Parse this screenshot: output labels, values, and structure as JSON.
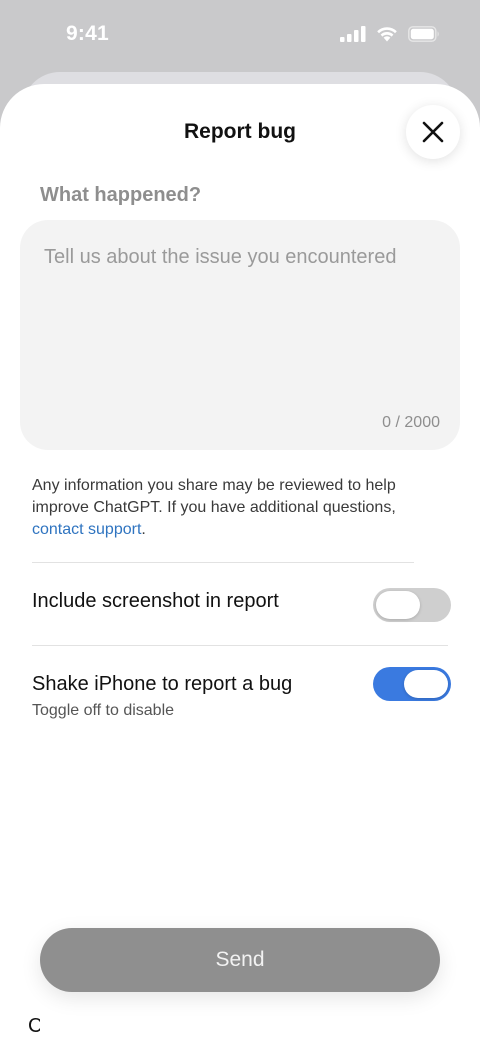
{
  "status_bar": {
    "time": "9:41",
    "icons": [
      "cellular-signal-icon",
      "wifi-icon",
      "battery-icon"
    ]
  },
  "sheet": {
    "title": "Report bug",
    "close_icon": "close-icon"
  },
  "form": {
    "section_label": "What happened?",
    "placeholder": "Tell us about the issue you encountered",
    "value": "",
    "char_count": "0 / 2000"
  },
  "disclaimer": {
    "text": "Any information you share may be reviewed to help improve ChatGPT. If you have additional questions,",
    "link": "contact support",
    "suffix": "."
  },
  "settings": {
    "screenshot": {
      "label": "Include screenshot in report",
      "enabled": false
    },
    "shake": {
      "label": "Shake iPhone to report a bug",
      "sublabel": "Toggle off to disable",
      "enabled": true
    }
  },
  "footer": {
    "send_label": "Send",
    "partial_glyph": "C"
  },
  "colors": {
    "accent": "#3a7ae0",
    "link": "#2f74c0",
    "send_disabled": "#8f8f8f",
    "toggle_off": "#cfcfcf"
  }
}
